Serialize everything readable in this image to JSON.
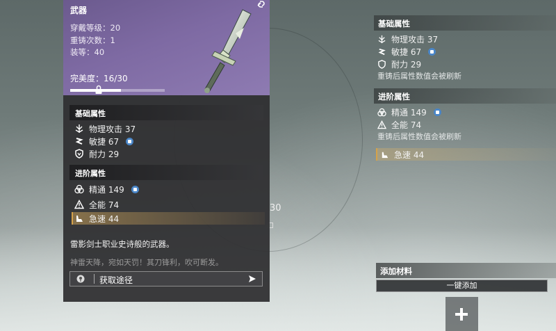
{
  "background": {
    "number_fragment": "30"
  },
  "item_card": {
    "title": "武器",
    "wear_level": "穿戴等级：20",
    "recast_count": "重铸次数：1",
    "gear_score": "装等：40",
    "perfection_label": "完美度：16/30",
    "perfection": {
      "current": 16,
      "max": 30
    },
    "base_section": {
      "title": "基础属性",
      "stats": [
        {
          "icon": "physical-attack-icon",
          "text": "物理攻击 37"
        },
        {
          "icon": "agility-icon",
          "text": "敏捷 67"
        },
        {
          "icon": "endurance-icon",
          "text": "耐力 29"
        }
      ]
    },
    "advanced_section": {
      "title": "进阶属性",
      "stats": [
        {
          "icon": "mastery-icon",
          "text": "精通 149"
        },
        {
          "icon": "versatility-icon",
          "text": "全能 74"
        },
        {
          "icon": "haste-icon",
          "text": "急速 44"
        }
      ]
    },
    "description": "雷影剑士职业史诗般的武器。",
    "quote": "神雷天降，宛如天罚！其刀锋利，吹可断发。",
    "source_button": "获取途径"
  },
  "compare_panel": {
    "base_title": "基础属性",
    "base_stats": [
      "物理攻击 37",
      "敏捷 67",
      "耐力 29"
    ],
    "base_note": "重铸后属性数值会被刷新",
    "advanced_title": "进阶属性",
    "advanced_stats": [
      "精通 149",
      "全能 74"
    ],
    "advanced_note": "重铸后属性数值会被刷新",
    "highlight_stat": "急速 44"
  },
  "materials": {
    "title": "添加材料",
    "one_key_add": "一键添加"
  },
  "colors": {
    "header_purple": "#7e6aa3",
    "badge_blue": "#4a86c8",
    "highlight_gold": "#d6a24a"
  }
}
